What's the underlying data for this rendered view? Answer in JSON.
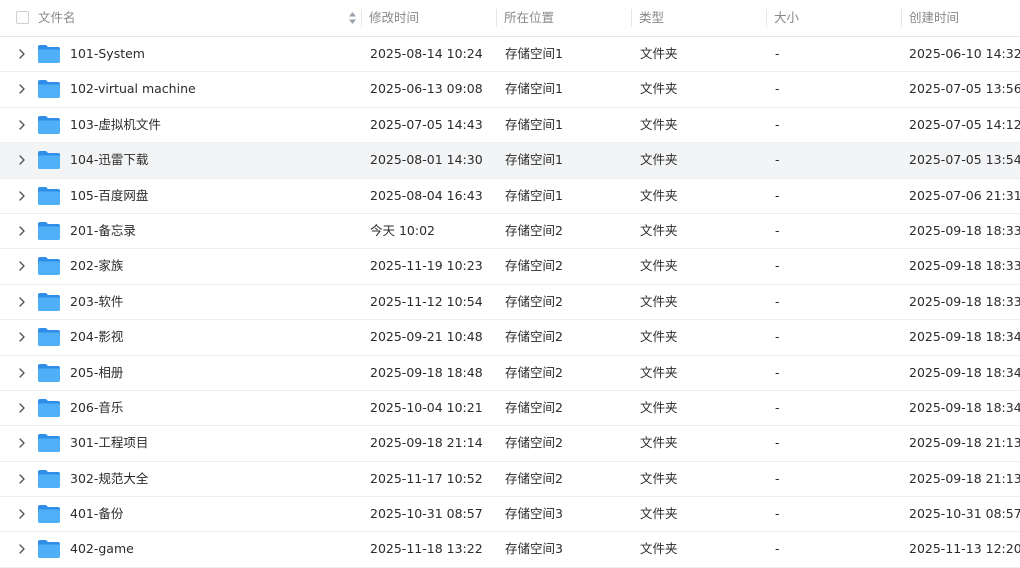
{
  "header": {
    "name": "文件名",
    "modified": "修改时间",
    "location": "所在位置",
    "type": "类型",
    "size": "大小",
    "created": "创建时间"
  },
  "colors": {
    "folder_back": "#2f8fe8",
    "folder_front": "#4fb0f8",
    "highlight_row": "#f3f4f6"
  },
  "rows": [
    {
      "name": "101-System",
      "modified": "2025-08-14 10:24",
      "location": "存储空间1",
      "type": "文件夹",
      "size": "-",
      "created": "2025-06-10 14:32"
    },
    {
      "name": "102-virtual machine",
      "modified": "2025-06-13 09:08",
      "location": "存储空间1",
      "type": "文件夹",
      "size": "-",
      "created": "2025-07-05 13:56"
    },
    {
      "name": "103-虚拟机文件",
      "modified": "2025-07-05 14:43",
      "location": "存储空间1",
      "type": "文件夹",
      "size": "-",
      "created": "2025-07-05 14:12"
    },
    {
      "name": "104-迅雷下载",
      "modified": "2025-08-01 14:30",
      "location": "存储空间1",
      "type": "文件夹",
      "size": "-",
      "created": "2025-07-05 13:54"
    },
    {
      "name": "105-百度网盘",
      "modified": "2025-08-04 16:43",
      "location": "存储空间1",
      "type": "文件夹",
      "size": "-",
      "created": "2025-07-06 21:31"
    },
    {
      "name": "201-备忘录",
      "modified": "今天 10:02",
      "location": "存储空间2",
      "type": "文件夹",
      "size": "-",
      "created": "2025-09-18 18:33"
    },
    {
      "name": "202-家族",
      "modified": "2025-11-19 10:23",
      "location": "存储空间2",
      "type": "文件夹",
      "size": "-",
      "created": "2025-09-18 18:33"
    },
    {
      "name": "203-软件",
      "modified": "2025-11-12 10:54",
      "location": "存储空间2",
      "type": "文件夹",
      "size": "-",
      "created": "2025-09-18 18:33"
    },
    {
      "name": "204-影视",
      "modified": "2025-09-21 10:48",
      "location": "存储空间2",
      "type": "文件夹",
      "size": "-",
      "created": "2025-09-18 18:34"
    },
    {
      "name": "205-相册",
      "modified": "2025-09-18 18:48",
      "location": "存储空间2",
      "type": "文件夹",
      "size": "-",
      "created": "2025-09-18 18:34"
    },
    {
      "name": "206-音乐",
      "modified": "2025-10-04 10:21",
      "location": "存储空间2",
      "type": "文件夹",
      "size": "-",
      "created": "2025-09-18 18:34"
    },
    {
      "name": "301-工程项目",
      "modified": "2025-09-18 21:14",
      "location": "存储空间2",
      "type": "文件夹",
      "size": "-",
      "created": "2025-09-18 21:13"
    },
    {
      "name": "302-规范大全",
      "modified": "2025-11-17 10:52",
      "location": "存储空间2",
      "type": "文件夹",
      "size": "-",
      "created": "2025-09-18 21:13"
    },
    {
      "name": "401-备份",
      "modified": "2025-10-31 08:57",
      "location": "存储空间3",
      "type": "文件夹",
      "size": "-",
      "created": "2025-10-31 08:57"
    },
    {
      "name": "402-game",
      "modified": "2025-11-18 13:22",
      "location": "存储空间3",
      "type": "文件夹",
      "size": "-",
      "created": "2025-11-13 12:20"
    }
  ],
  "highlighted_row": 3
}
